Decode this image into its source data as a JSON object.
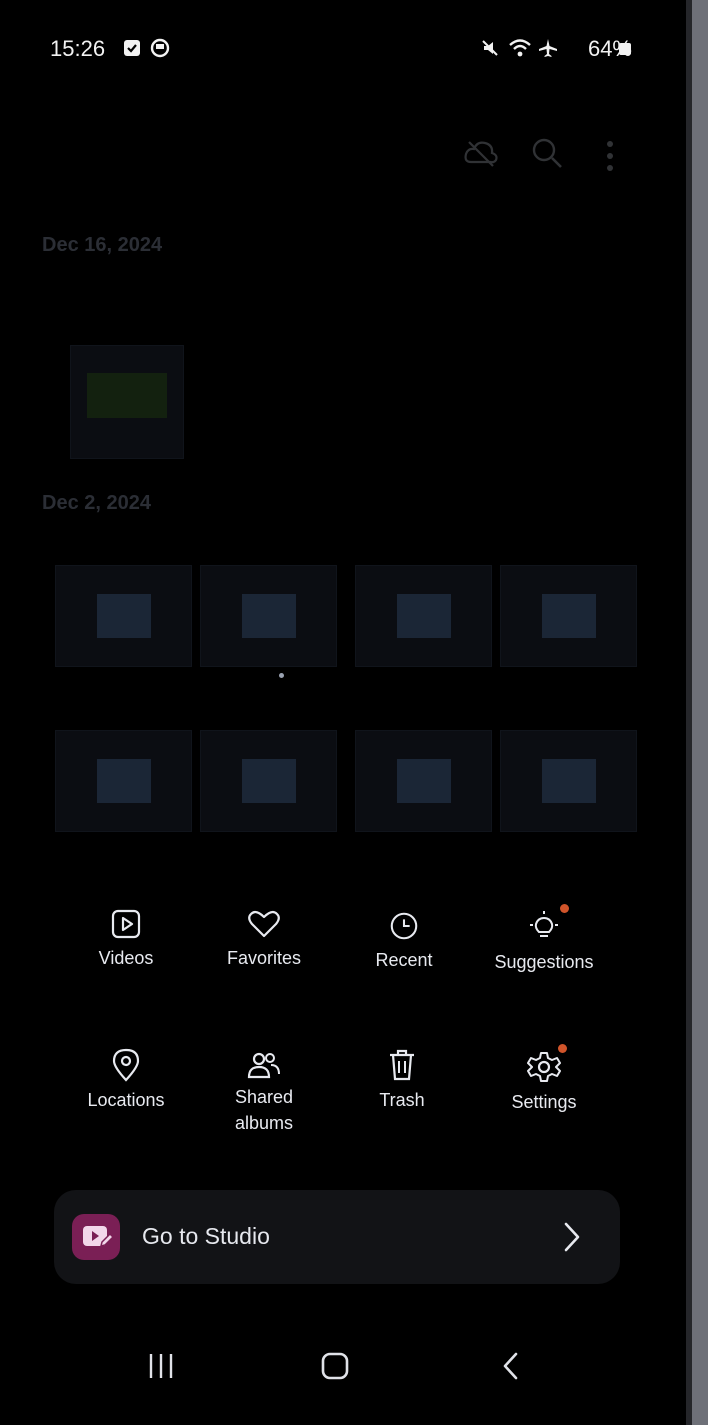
{
  "status_bar": {
    "time": "15:26",
    "battery": "64%",
    "icons": [
      "sim-icon",
      "app-icon",
      "mute-icon",
      "wifi-icon",
      "airplane-icon",
      "battery-icon"
    ]
  },
  "header": {
    "icons": [
      "cloud-icon",
      "search-icon",
      "more-options-icon"
    ]
  },
  "gallery": {
    "sections": [
      {
        "date": "Dec 16, 2024"
      },
      {
        "date": "Dec 2, 2024"
      }
    ]
  },
  "menu": {
    "items": [
      {
        "label": "Videos",
        "icon": "video-icon"
      },
      {
        "label": "Favorites",
        "icon": "heart-icon"
      },
      {
        "label": "Recent",
        "icon": "clock-icon"
      },
      {
        "label": "Suggestions",
        "icon": "lightbulb-icon"
      },
      {
        "label": "Locations",
        "icon": "location-pin-icon"
      },
      {
        "label": "Shared albums",
        "icon": "people-icon"
      },
      {
        "label": "Trash",
        "icon": "trash-icon"
      },
      {
        "label": "Settings",
        "icon": "gear-icon"
      }
    ],
    "studio_label": "Go to Studio"
  },
  "nav_bar": {
    "icons": [
      "recents-icon",
      "home-icon",
      "back-icon"
    ]
  },
  "colors": {
    "background": "#000000",
    "accent_badge": "#d0542a",
    "studio_icon": "#7a1f55"
  }
}
